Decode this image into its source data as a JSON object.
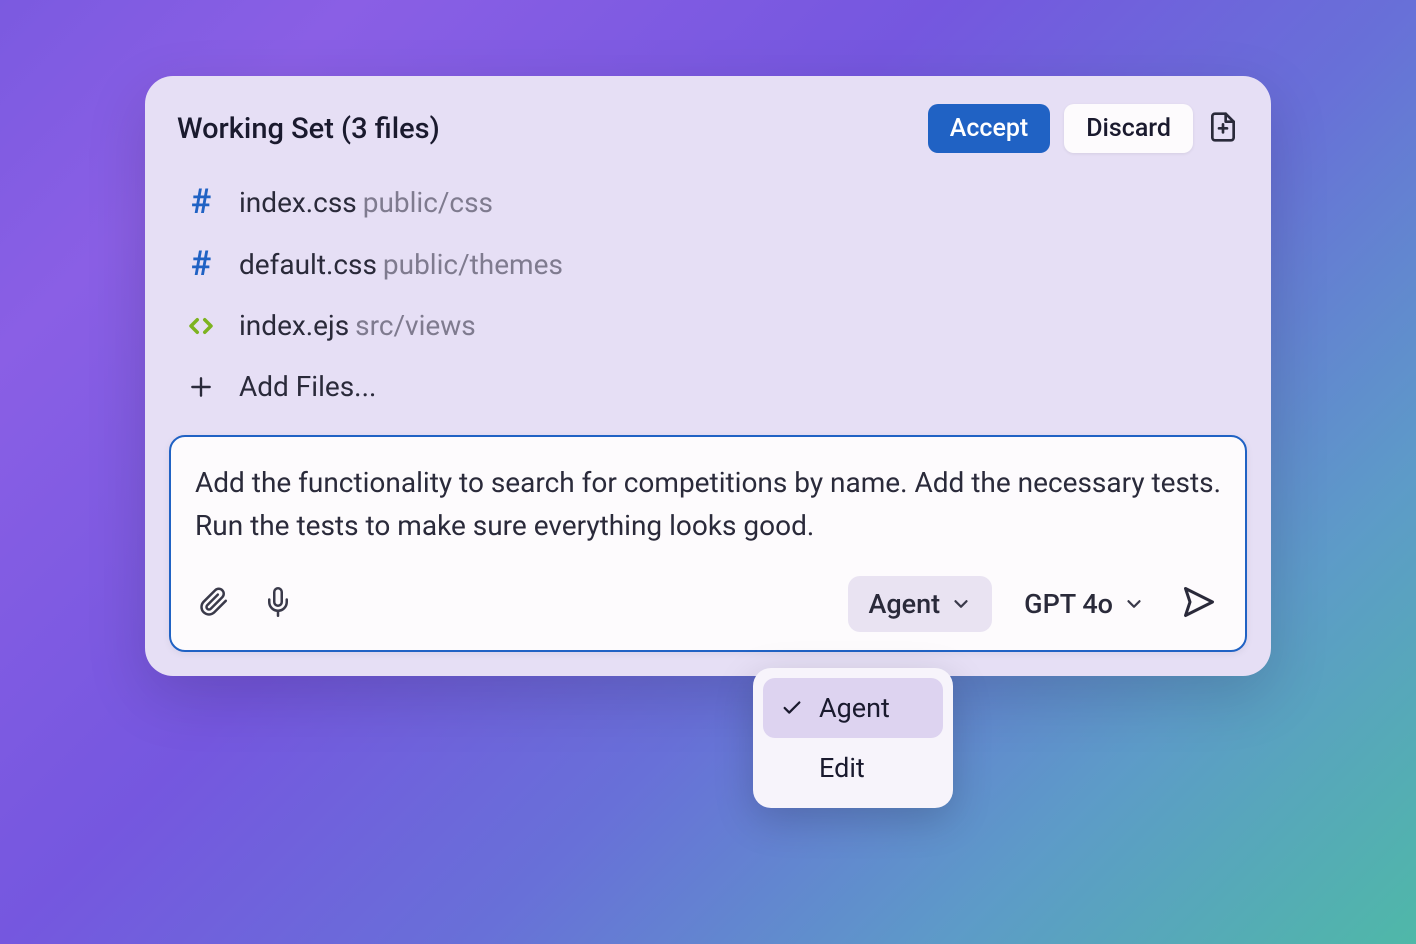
{
  "header": {
    "title": "Working Set (3 files)",
    "accept_label": "Accept",
    "discard_label": "Discard"
  },
  "files": [
    {
      "icon": "hash",
      "name": "index.css",
      "path": "public/css"
    },
    {
      "icon": "hash",
      "name": "default.css",
      "path": "public/themes"
    },
    {
      "icon": "code",
      "name": "index.ejs",
      "path": "src/views"
    }
  ],
  "add_files_label": "Add Files...",
  "prompt": {
    "value": "Add the functionality to search for competitions by name. Add the necessary tests. Run the tests to make sure everything looks good."
  },
  "toolbar": {
    "mode_label": "Agent",
    "model_label": "GPT 4o"
  },
  "mode_menu": {
    "items": [
      {
        "label": "Agent",
        "selected": true
      },
      {
        "label": "Edit",
        "selected": false
      }
    ]
  },
  "colors": {
    "accent": "#2062c4",
    "panel_bg": "#e6dff5",
    "card_bg": "#fdfbfd"
  }
}
